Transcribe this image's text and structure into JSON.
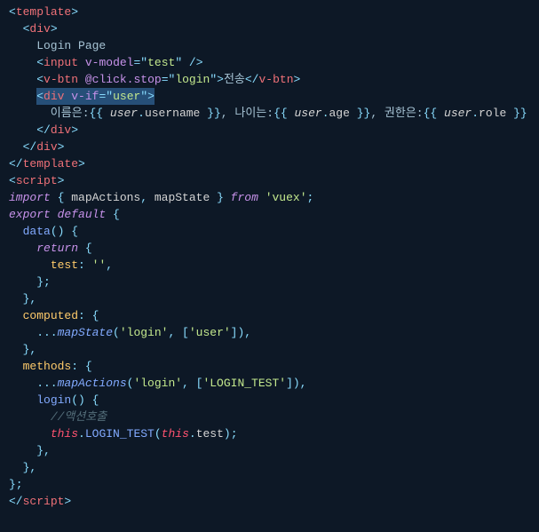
{
  "code": {
    "l1": {
      "p1": "<",
      "p2": "template",
      "p3": ">"
    },
    "l2": {
      "p1": "  ",
      "p2": "<",
      "p3": "div",
      "p4": ">"
    },
    "l3": {
      "p1": "    Login Page"
    },
    "l4": {
      "p1": "    ",
      "p2": "<",
      "p3": "input",
      "p4": " ",
      "p5": "v-model",
      "p6": "=",
      "p7": "\"",
      "p8": "test",
      "p9": "\"",
      "p10": " />"
    },
    "l5": {
      "p1": "    ",
      "p2": "<",
      "p3": "v-btn",
      "p4": " ",
      "p5": "@click.stop",
      "p6": "=",
      "p7": "\"",
      "p8": "login",
      "p9": "\"",
      "p10": ">",
      "p11": "전송",
      "p12": "</",
      "p13": "v-btn",
      "p14": ">"
    },
    "l6": {
      "p1": "    ",
      "p2": "<",
      "p3": "div",
      "p4": " ",
      "p5": "v-if",
      "p6": "=",
      "p7": "\"",
      "p8": "user",
      "p9": "\"",
      "p10": ">"
    },
    "l7": {
      "p1": "      이름은:",
      "p2": "{{ ",
      "p3": "user",
      "p4": ".",
      "p5": "username",
      "p6": " }}",
      "p7": ", 나이는:",
      "p8": "{{ ",
      "p9": "user",
      "p10": ".",
      "p11": "age",
      "p12": " }}",
      "p13": ", 권한은:",
      "p14": "{{ ",
      "p15": "user",
      "p16": ".",
      "p17": "role",
      "p18": " }}"
    },
    "l8": {
      "p1": "    ",
      "p2": "</",
      "p3": "div",
      "p4": ">"
    },
    "l9": {
      "p1": "  ",
      "p2": "</",
      "p3": "div",
      "p4": ">"
    },
    "l10": {
      "p1": "</",
      "p2": "template",
      "p3": ">"
    },
    "l11": {
      "p1": ""
    },
    "l12": {
      "p1": ""
    },
    "l13": {
      "p1": "<",
      "p2": "script",
      "p3": ">"
    },
    "l14": {
      "p1": "import",
      "p2": " { ",
      "p3": "mapActions",
      "p4": ", ",
      "p5": "mapState",
      "p6": " } ",
      "p7": "from",
      "p8": " ",
      "p9": "'vuex'",
      "p10": ";"
    },
    "l15": {
      "p1": "export",
      "p2": " ",
      "p3": "default",
      "p4": " {"
    },
    "l16": {
      "p1": "  ",
      "p2": "data",
      "p3": "() {"
    },
    "l17": {
      "p1": "    ",
      "p2": "return",
      "p3": " {"
    },
    "l18": {
      "p1": "      ",
      "p2": "test",
      "p3": ": ",
      "p4": "''",
      "p5": ","
    },
    "l19": {
      "p1": "    };"
    },
    "l20": {
      "p1": "  },"
    },
    "l21": {
      "p1": "  ",
      "p2": "computed",
      "p3": ": {"
    },
    "l22": {
      "p1": "    ...",
      "p2": "mapState",
      "p3": "(",
      "p4": "'login'",
      "p5": ", [",
      "p6": "'user'",
      "p7": "]),"
    },
    "l23": {
      "p1": "  },"
    },
    "l24": {
      "p1": "  ",
      "p2": "methods",
      "p3": ": {"
    },
    "l25": {
      "p1": "    ...",
      "p2": "mapActions",
      "p3": "(",
      "p4": "'login'",
      "p5": ", [",
      "p6": "'LOGIN_TEST'",
      "p7": "]),"
    },
    "l26": {
      "p1": "    ",
      "p2": "login",
      "p3": "() {"
    },
    "l27": {
      "p1": "      ",
      "p2": "//액션호출"
    },
    "l28": {
      "p1": "      ",
      "p2": "this",
      "p3": ".",
      "p4": "LOGIN_TEST",
      "p5": "(",
      "p6": "this",
      "p7": ".",
      "p8": "test",
      "p9": ");"
    },
    "l29": {
      "p1": "    },"
    },
    "l30": {
      "p1": "  },"
    },
    "l31": {
      "p1": "};"
    },
    "l32": {
      "p1": "</",
      "p2": "script",
      "p3": ">"
    }
  }
}
